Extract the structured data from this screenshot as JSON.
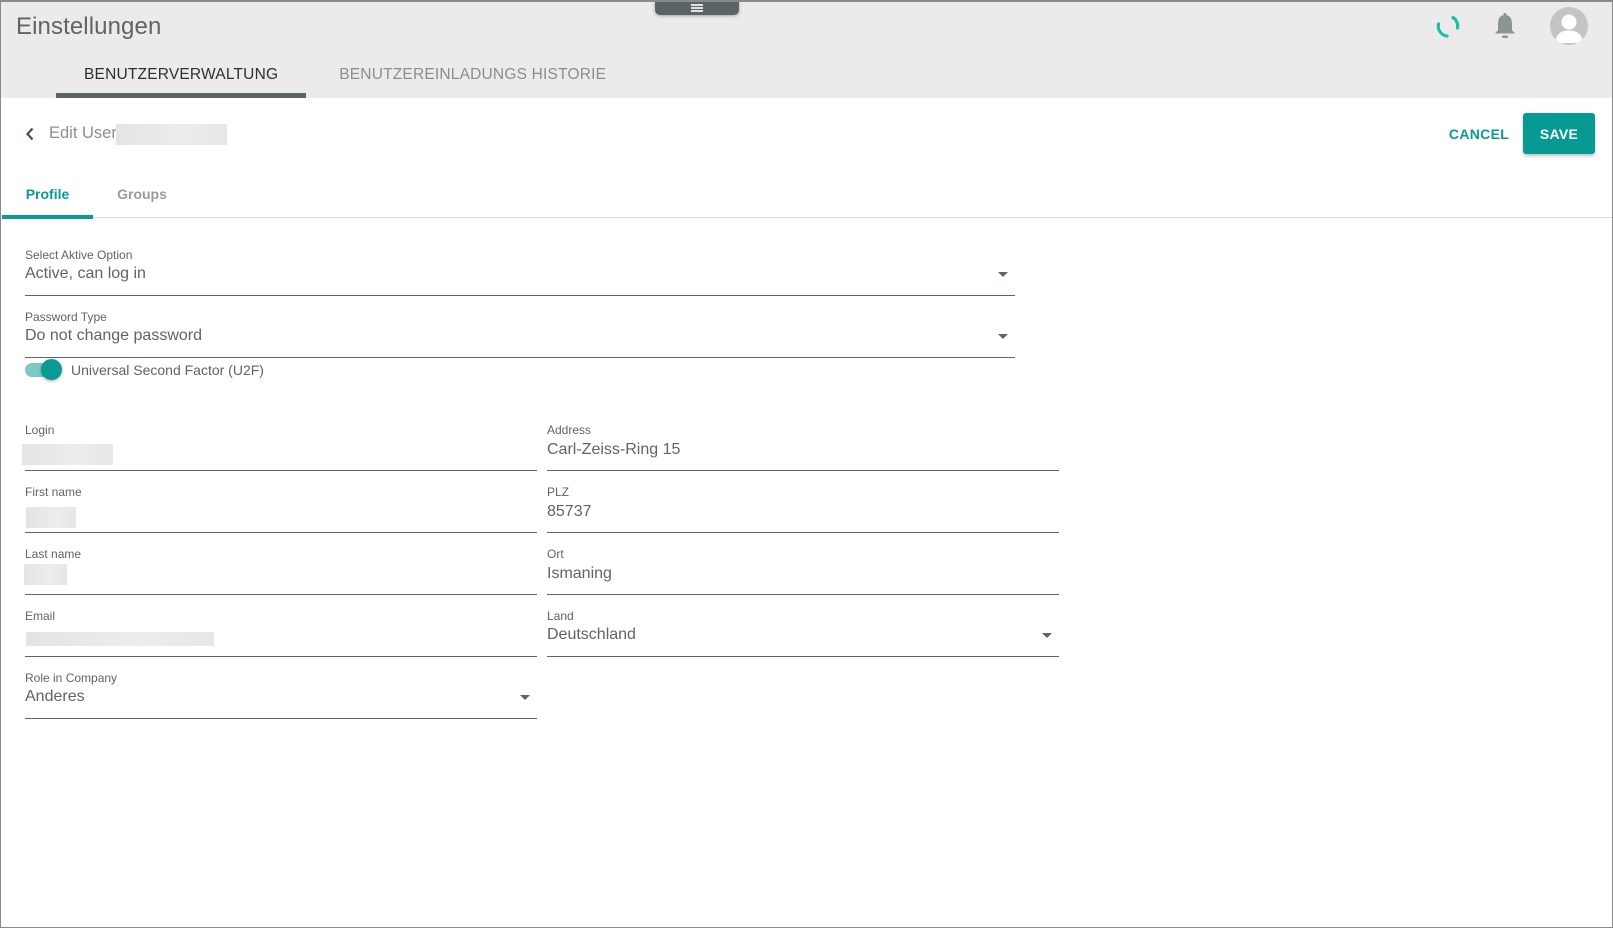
{
  "header": {
    "title": "Einstellungen",
    "tabs": [
      {
        "label": "BENUTZERVERWALTUNG",
        "active": true
      },
      {
        "label": "BENUTZEREINLADUNGS HISTORIE",
        "active": false
      }
    ],
    "icons": {
      "handle": "menu-handle-icon",
      "spinner": "loading-spinner-icon",
      "notifications": "bell-icon",
      "account": "user-avatar-icon"
    }
  },
  "edit_bar": {
    "back_icon": "chevron-left-icon",
    "title": "Edit User",
    "cancel_label": "CANCEL",
    "save_label": "SAVE"
  },
  "sub_tabs": [
    {
      "label": "Profile",
      "active": true
    },
    {
      "label": "Groups",
      "active": false
    }
  ],
  "form": {
    "active_option": {
      "label": "Select Aktive Option",
      "value": "Active, can log in"
    },
    "password_type": {
      "label": "Password Type",
      "value": "Do not change password"
    },
    "u2f": {
      "label": "Universal Second Factor (U2F)",
      "enabled": true
    },
    "login": {
      "label": "Login",
      "value": ""
    },
    "first_name": {
      "label": "First name",
      "value": ""
    },
    "last_name": {
      "label": "Last name",
      "value": ""
    },
    "email": {
      "label": "Email",
      "value": ""
    },
    "role": {
      "label": "Role in Company",
      "value": "Anderes"
    },
    "address": {
      "label": "Address",
      "value": "Carl-Zeiss-Ring 15"
    },
    "plz": {
      "label": "PLZ",
      "value": "85737"
    },
    "ort": {
      "label": "Ort",
      "value": "Ismaning"
    },
    "land": {
      "label": "Land",
      "value": "Deutschland"
    }
  },
  "colors": {
    "accent": "#089a93",
    "header_bg": "#ebebeb",
    "tab_indicator": "#5a6465",
    "text": "#5f6466"
  }
}
